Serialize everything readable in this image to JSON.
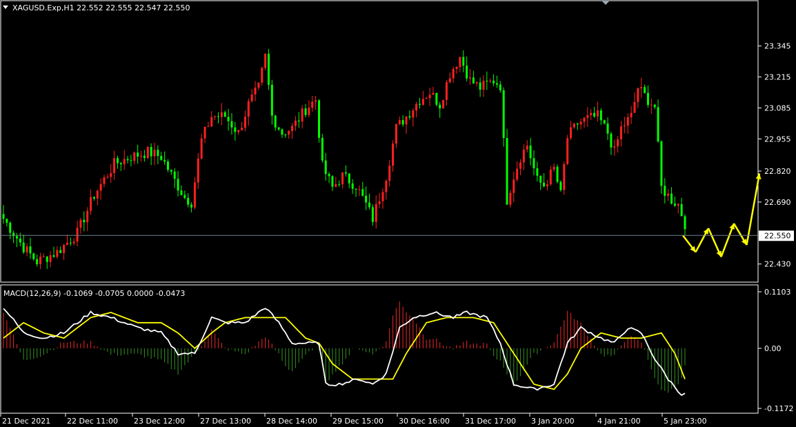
{
  "colors": {
    "background": "#000000",
    "frame": "#ffffff",
    "bull": "#ff2020",
    "bear": "#00ff00",
    "wick_bull": "#ff2020",
    "wick_bear": "#00ff00",
    "macd_pos": "#cc2222",
    "macd_neg": "#2e7d1e",
    "macd_line": "#ffffff",
    "signal_line": "#ffff00",
    "forecast": "#ffff00",
    "price_line": "#708090",
    "text": "#ffffff"
  },
  "main": {
    "header_text": "XAGUSD.Exp,H1  22.552 22.555 22.547 22.550",
    "current_price": "22.550"
  },
  "macd": {
    "header_text": "MACD(12,26,9) -0.1069 -0.0705 0.0000 -0.0473"
  },
  "chart_data": [
    {
      "type": "candlestick",
      "symbol": "XAGUSD.Exp",
      "timeframe": "H1",
      "ylim": [
        22.38,
        23.48
      ],
      "price_ticks": [
        "23.345",
        "23.215",
        "23.085",
        "22.955",
        "22.820",
        "22.690",
        "22.550",
        "22.430"
      ],
      "current_price": 22.55,
      "close_path": [
        [
          0,
          22.62
        ],
        [
          6,
          22.5
        ],
        [
          10,
          22.44
        ],
        [
          16,
          22.48
        ],
        [
          22,
          22.56
        ],
        [
          27,
          22.72
        ],
        [
          33,
          22.85
        ],
        [
          38,
          22.88
        ],
        [
          43,
          22.9
        ],
        [
          47,
          22.88
        ],
        [
          51,
          22.78
        ],
        [
          54,
          22.71
        ],
        [
          56,
          22.69
        ],
        [
          59,
          22.95
        ],
        [
          62,
          23.05
        ],
        [
          66,
          23.05
        ],
        [
          70,
          22.98
        ],
        [
          73,
          23.1
        ],
        [
          76,
          23.17
        ],
        [
          78,
          23.3
        ],
        [
          80,
          23.05
        ],
        [
          83,
          22.98
        ],
        [
          86,
          23.0
        ],
        [
          90,
          23.08
        ],
        [
          93,
          23.12
        ],
        [
          95,
          22.84
        ],
        [
          98,
          22.75
        ],
        [
          101,
          22.8
        ],
        [
          105,
          22.76
        ],
        [
          108,
          22.68
        ],
        [
          110,
          22.62
        ],
        [
          114,
          22.8
        ],
        [
          117,
          23.0
        ],
        [
          120,
          23.05
        ],
        [
          124,
          23.12
        ],
        [
          127,
          23.15
        ],
        [
          130,
          23.1
        ],
        [
          133,
          23.23
        ],
        [
          136,
          23.3
        ],
        [
          139,
          23.2
        ],
        [
          142,
          23.17
        ],
        [
          146,
          23.2
        ],
        [
          148,
          23.18
        ],
        [
          150,
          22.7
        ],
        [
          152,
          22.8
        ],
        [
          154,
          22.88
        ],
        [
          156,
          22.93
        ],
        [
          159,
          22.78
        ],
        [
          161,
          22.76
        ],
        [
          164,
          22.83
        ],
        [
          166,
          22.72
        ],
        [
          168,
          22.96
        ],
        [
          171,
          23.02
        ],
        [
          174,
          23.04
        ],
        [
          177,
          23.05
        ],
        [
          180,
          22.98
        ],
        [
          182,
          22.9
        ],
        [
          184,
          23.0
        ],
        [
          187,
          23.05
        ],
        [
          189,
          23.17
        ],
        [
          192,
          23.12
        ],
        [
          194,
          23.09
        ],
        [
          196,
          22.75
        ],
        [
          199,
          22.7
        ],
        [
          201,
          22.68
        ],
        [
          203,
          22.6
        ]
      ],
      "forecast_path": [
        [
          22.55,
          22.48
        ],
        [
          22.48,
          22.58
        ],
        [
          22.58,
          22.46
        ],
        [
          22.46,
          22.6
        ],
        [
          22.6,
          22.51
        ],
        [
          22.51,
          22.81
        ]
      ],
      "x_labels": [
        "21 Dec 2021",
        "22 Dec 11:00",
        "23 Dec 12:00",
        "27 Dec 13:00",
        "28 Dec 14:00",
        "29 Dec 15:00",
        "30 Dec 16:00",
        "31 Dec 17:00",
        "3 Jan 20:00",
        "4 Jan 21:00",
        "5 Jan 23:00"
      ]
    },
    {
      "type": "macd",
      "params": "12,26,9",
      "ylim": [
        -0.1172,
        0.1103
      ],
      "ticks": [
        "0.1103",
        "0.00",
        "-0.1172"
      ],
      "macd_path": [
        [
          0,
          0.08
        ],
        [
          6,
          0.03
        ],
        [
          12,
          0.02
        ],
        [
          18,
          0.03
        ],
        [
          26,
          0.07
        ],
        [
          32,
          0.06
        ],
        [
          40,
          0.04
        ],
        [
          47,
          0.03
        ],
        [
          52,
          -0.01
        ],
        [
          57,
          -0.01
        ],
        [
          62,
          0.06
        ],
        [
          66,
          0.05
        ],
        [
          72,
          0.05
        ],
        [
          78,
          0.08
        ],
        [
          82,
          0.05
        ],
        [
          86,
          0.01
        ],
        [
          90,
          0.01
        ],
        [
          94,
          0.01
        ],
        [
          96,
          -0.07
        ],
        [
          100,
          -0.07
        ],
        [
          106,
          -0.06
        ],
        [
          110,
          -0.07
        ],
        [
          114,
          -0.05
        ],
        [
          118,
          0.04
        ],
        [
          122,
          0.06
        ],
        [
          128,
          0.07
        ],
        [
          134,
          0.06
        ],
        [
          138,
          0.07
        ],
        [
          144,
          0.06
        ],
        [
          148,
          0.01
        ],
        [
          152,
          -0.07
        ],
        [
          158,
          -0.08
        ],
        [
          164,
          -0.07
        ],
        [
          168,
          0.01
        ],
        [
          172,
          0.04
        ],
        [
          178,
          0.02
        ],
        [
          182,
          0.01
        ],
        [
          186,
          0.04
        ],
        [
          190,
          0.03
        ],
        [
          194,
          -0.02
        ],
        [
          198,
          -0.06
        ],
        [
          202,
          -0.09
        ]
      ],
      "signal_path": [
        [
          0,
          0.02
        ],
        [
          6,
          0.05
        ],
        [
          12,
          0.03
        ],
        [
          18,
          0.02
        ],
        [
          26,
          0.06
        ],
        [
          32,
          0.07
        ],
        [
          40,
          0.05
        ],
        [
          47,
          0.05
        ],
        [
          52,
          0.03
        ],
        [
          57,
          0.0
        ],
        [
          62,
          0.03
        ],
        [
          66,
          0.05
        ],
        [
          72,
          0.06
        ],
        [
          78,
          0.06
        ],
        [
          84,
          0.06
        ],
        [
          90,
          0.02
        ],
        [
          94,
          0.01
        ],
        [
          98,
          -0.03
        ],
        [
          104,
          -0.06
        ],
        [
          110,
          -0.06
        ],
        [
          116,
          -0.06
        ],
        [
          120,
          -0.01
        ],
        [
          126,
          0.05
        ],
        [
          132,
          0.06
        ],
        [
          140,
          0.06
        ],
        [
          146,
          0.05
        ],
        [
          152,
          -0.01
        ],
        [
          158,
          -0.07
        ],
        [
          164,
          -0.08
        ],
        [
          168,
          -0.05
        ],
        [
          172,
          0.0
        ],
        [
          178,
          0.03
        ],
        [
          184,
          0.02
        ],
        [
          190,
          0.02
        ],
        [
          196,
          0.03
        ],
        [
          200,
          -0.01
        ],
        [
          203,
          -0.06
        ]
      ]
    }
  ]
}
